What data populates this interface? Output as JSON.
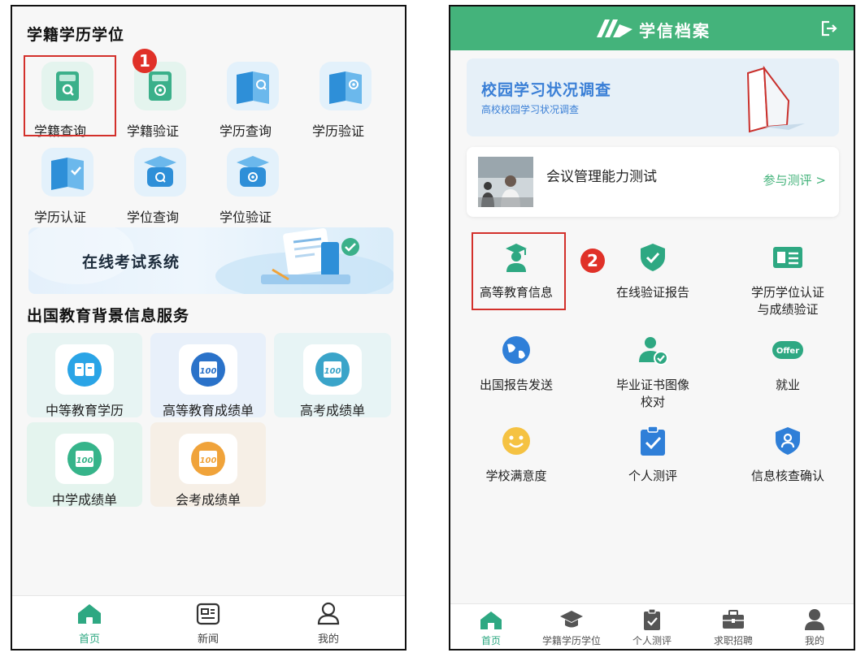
{
  "left": {
    "section1_title": "学籍学历学位",
    "grid": [
      {
        "label": "学籍查询",
        "icon": "student-record-search-icon"
      },
      {
        "label": "学籍验证",
        "icon": "student-record-verify-icon"
      },
      {
        "label": "学历查询",
        "icon": "education-search-icon"
      },
      {
        "label": "学历验证",
        "icon": "education-verify-icon"
      },
      {
        "label": "学历认证",
        "icon": "education-certify-icon"
      },
      {
        "label": "学位查询",
        "icon": "degree-search-icon"
      },
      {
        "label": "学位验证",
        "icon": "degree-verify-icon"
      }
    ],
    "badge": "1",
    "banner": "在线考试系统",
    "section2_title": "出国教育背景信息服务",
    "cards": [
      {
        "label": "中等教育学历",
        "icon": "book-icon",
        "color": "#2aa4e6"
      },
      {
        "label": "高等教育成绩单",
        "icon": "score-100-icon",
        "color": "#2a72c9"
      },
      {
        "label": "高考成绩单",
        "icon": "score-100-icon",
        "color": "#3aa4c9"
      },
      {
        "label": "中学成绩单",
        "icon": "score-100-icon",
        "color": "#36b48a"
      },
      {
        "label": "会考成绩单",
        "icon": "score-100-icon",
        "color": "#f0a33a"
      }
    ],
    "tabs": [
      {
        "label": "首页",
        "icon": "home-icon",
        "active": true
      },
      {
        "label": "新闻",
        "icon": "news-icon",
        "active": false
      },
      {
        "label": "我的",
        "icon": "user-icon",
        "active": false
      }
    ]
  },
  "right": {
    "header_title": "学信档案",
    "survey": {
      "title": "校园学习状况调查",
      "subtitle": "高校校园学习状况调查"
    },
    "test": {
      "title": "会议管理能力测试",
      "link": "参与测评 >"
    },
    "badge": "2",
    "services": [
      {
        "label": "高等教育信息",
        "icon": "graduate-icon"
      },
      {
        "label": "在线验证报告",
        "icon": "shield-check-icon"
      },
      {
        "label": "学历学位认证\n与成绩验证",
        "icon": "id-card-icon"
      },
      {
        "label": "出国报告发送",
        "icon": "globe-icon"
      },
      {
        "label": "毕业证书图像\n校对",
        "icon": "user-check-icon"
      },
      {
        "label": "就业",
        "icon": "offer-icon"
      },
      {
        "label": "学校满意度",
        "icon": "smile-icon"
      },
      {
        "label": "个人测评",
        "icon": "clipboard-check-icon"
      },
      {
        "label": "信息核查确认",
        "icon": "user-shield-icon"
      }
    ],
    "tabs": [
      {
        "label": "首页",
        "icon": "home-icon",
        "active": true
      },
      {
        "label": "学籍学历学位",
        "icon": "grad-cap-icon",
        "active": false
      },
      {
        "label": "个人测评",
        "icon": "clipboard-icon",
        "active": false
      },
      {
        "label": "求职招聘",
        "icon": "briefcase-icon",
        "active": false
      },
      {
        "label": "我的",
        "icon": "user-icon",
        "active": false
      }
    ],
    "colors": {
      "brand": "#44b37b",
      "blue": "#3a7fd6"
    }
  }
}
